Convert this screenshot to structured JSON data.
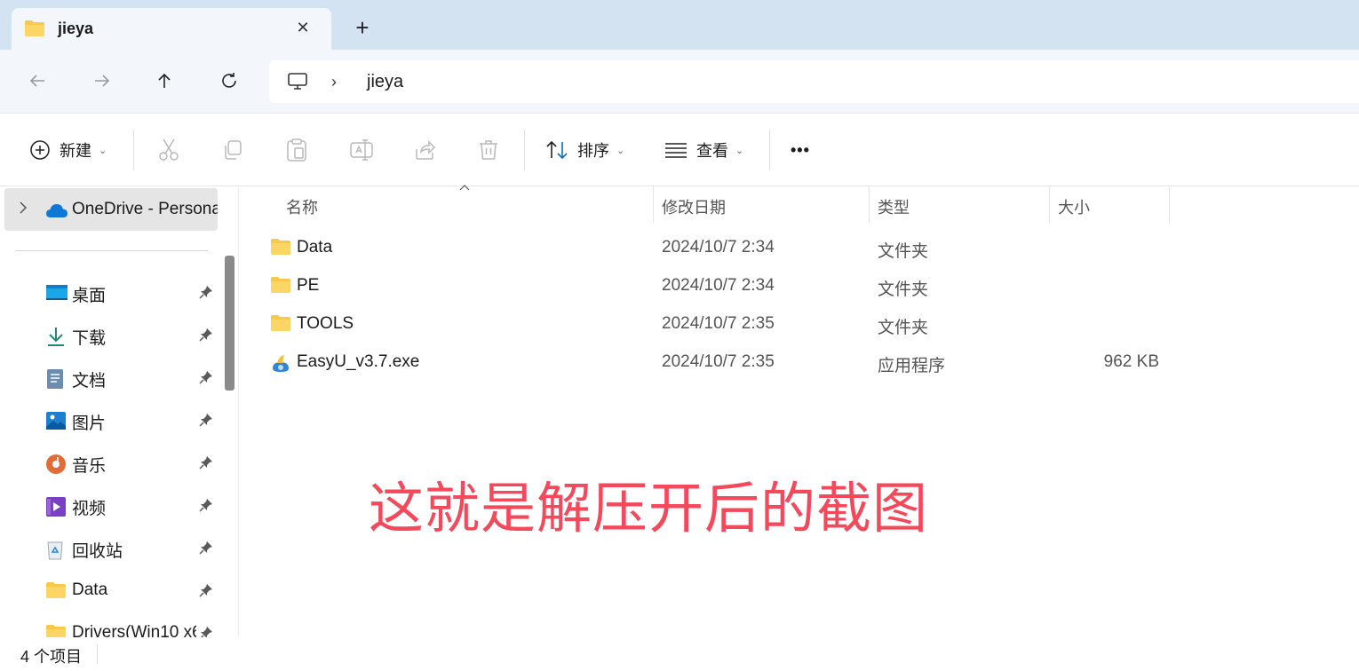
{
  "tab": {
    "title": "jieya",
    "close_glyph": "✕",
    "new_tab_glyph": "+"
  },
  "nav": {
    "back": "←",
    "forward": "→",
    "up": "↑",
    "refresh": "⟳",
    "separator": "›",
    "breadcrumb": "jieya"
  },
  "commands": {
    "new": "新建",
    "sort": "排序",
    "view": "查看",
    "more": "•••",
    "chevron": "⌄"
  },
  "sidebar": {
    "onedrive": "OneDrive - Persona",
    "items": [
      {
        "label": "桌面",
        "icon": "desktop-icon"
      },
      {
        "label": "下载",
        "icon": "download-icon"
      },
      {
        "label": "文档",
        "icon": "documents-icon"
      },
      {
        "label": "图片",
        "icon": "pictures-icon"
      },
      {
        "label": "音乐",
        "icon": "music-icon"
      },
      {
        "label": "视频",
        "icon": "videos-icon"
      },
      {
        "label": "回收站",
        "icon": "recycle-bin-icon"
      },
      {
        "label": "Data",
        "icon": "folder-icon"
      },
      {
        "label": "Drivers(Win10 x6",
        "icon": "folder-icon"
      }
    ]
  },
  "columns": {
    "name": "名称",
    "date": "修改日期",
    "type": "类型",
    "size": "大小"
  },
  "files": [
    {
      "name": "Data",
      "date": "2024/10/7 2:34",
      "type": "文件夹",
      "size": ""
    },
    {
      "name": "PE",
      "date": "2024/10/7 2:34",
      "type": "文件夹",
      "size": ""
    },
    {
      "name": "TOOLS",
      "date": "2024/10/7 2:35",
      "type": "文件夹",
      "size": ""
    },
    {
      "name": "EasyU_v3.7.exe",
      "date": "2024/10/7 2:35",
      "type": "应用程序",
      "size": "962 KB"
    }
  ],
  "annotation": "这就是解压开后的截图",
  "status": {
    "count": "4 个项目"
  },
  "colors": {
    "annotation": "#f4495b",
    "tabstrip": "#d3e3f1",
    "folder": "#f8c84a",
    "accent": "#0f6cbd"
  }
}
